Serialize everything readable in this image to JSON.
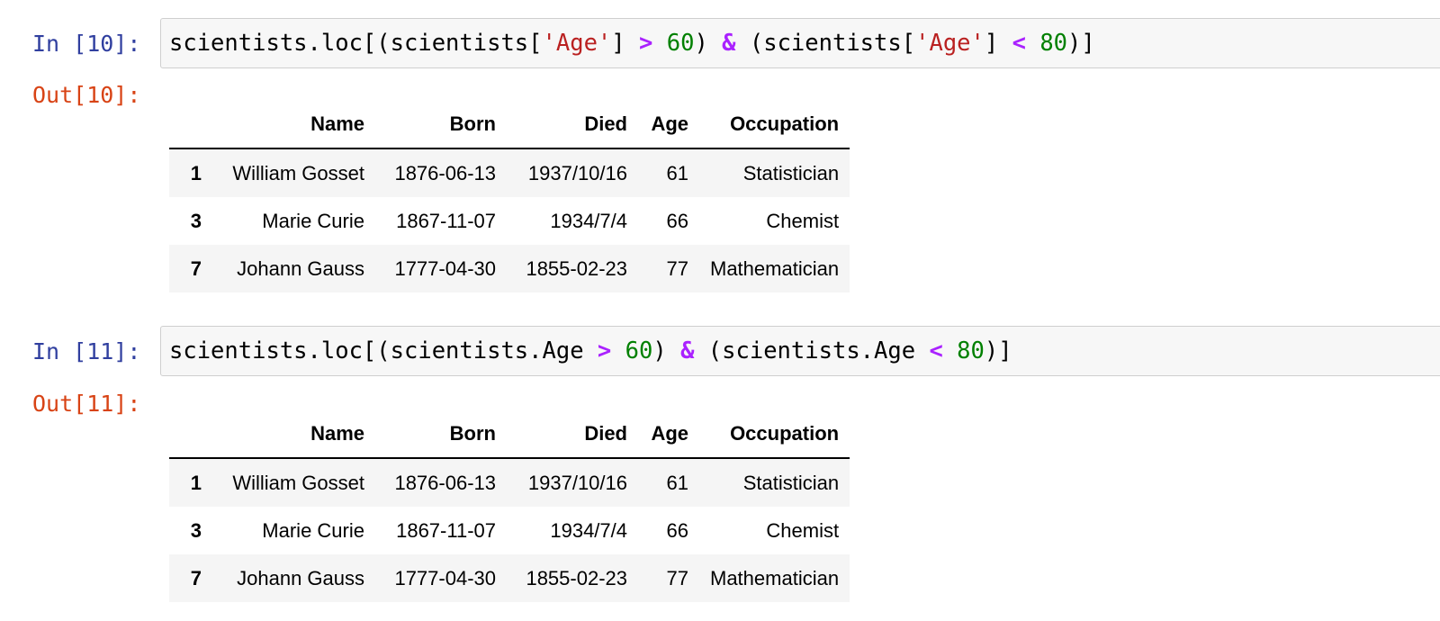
{
  "cells": [
    {
      "in_prompt": "In [10]:",
      "out_prompt": "Out[10]:",
      "code_tokens": [
        {
          "t": "scientists.loc[(scientists[",
          "k": "plain"
        },
        {
          "t": "'Age'",
          "k": "str"
        },
        {
          "t": "] ",
          "k": "plain"
        },
        {
          "t": ">",
          "k": "op"
        },
        {
          "t": " ",
          "k": "plain"
        },
        {
          "t": "60",
          "k": "num"
        },
        {
          "t": ") ",
          "k": "plain"
        },
        {
          "t": "&",
          "k": "op"
        },
        {
          "t": " (scientists[",
          "k": "plain"
        },
        {
          "t": "'Age'",
          "k": "str"
        },
        {
          "t": "] ",
          "k": "plain"
        },
        {
          "t": "<",
          "k": "op"
        },
        {
          "t": " ",
          "k": "plain"
        },
        {
          "t": "80",
          "k": "num"
        },
        {
          "t": ")]",
          "k": "plain"
        }
      ],
      "table": {
        "columns": [
          "",
          "Name",
          "Born",
          "Died",
          "Age",
          "Occupation"
        ],
        "rows": [
          {
            "index": "1",
            "name": "William Gosset",
            "born": "1876-06-13",
            "died": "1937/10/16",
            "age": "61",
            "occupation": "Statistician"
          },
          {
            "index": "3",
            "name": "Marie Curie",
            "born": "1867-11-07",
            "died": "1934/7/4",
            "age": "66",
            "occupation": "Chemist"
          },
          {
            "index": "7",
            "name": "Johann Gauss",
            "born": "1777-04-30",
            "died": "1855-02-23",
            "age": "77",
            "occupation": "Mathematician"
          }
        ]
      }
    },
    {
      "in_prompt": "In [11]:",
      "out_prompt": "Out[11]:",
      "code_tokens": [
        {
          "t": "scientists.loc[(scientists.Age ",
          "k": "plain"
        },
        {
          "t": ">",
          "k": "op"
        },
        {
          "t": " ",
          "k": "plain"
        },
        {
          "t": "60",
          "k": "num"
        },
        {
          "t": ") ",
          "k": "plain"
        },
        {
          "t": "&",
          "k": "op"
        },
        {
          "t": " (scientists.Age ",
          "k": "plain"
        },
        {
          "t": "<",
          "k": "op"
        },
        {
          "t": " ",
          "k": "plain"
        },
        {
          "t": "80",
          "k": "num"
        },
        {
          "t": ")]",
          "k": "plain"
        }
      ],
      "table": {
        "columns": [
          "",
          "Name",
          "Born",
          "Died",
          "Age",
          "Occupation"
        ],
        "rows": [
          {
            "index": "1",
            "name": "William Gosset",
            "born": "1876-06-13",
            "died": "1937/10/16",
            "age": "61",
            "occupation": "Statistician"
          },
          {
            "index": "3",
            "name": "Marie Curie",
            "born": "1867-11-07",
            "died": "1934/7/4",
            "age": "66",
            "occupation": "Chemist"
          },
          {
            "index": "7",
            "name": "Johann Gauss",
            "born": "1777-04-30",
            "died": "1855-02-23",
            "age": "77",
            "occupation": "Mathematician"
          }
        ]
      }
    }
  ],
  "colors": {
    "in_prompt": "#303f9f",
    "out_prompt": "#d84315",
    "string": "#ba2121",
    "operator": "#aa22ff",
    "number": "#008000",
    "input_background": "#f7f7f7",
    "odd_row_background": "#f5f5f5"
  }
}
